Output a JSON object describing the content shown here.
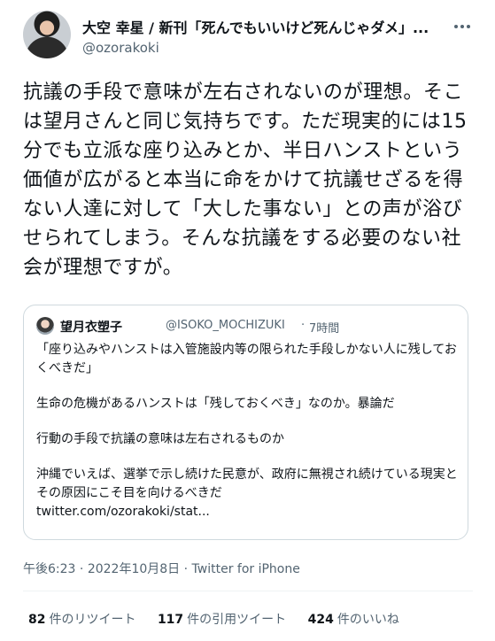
{
  "author": {
    "display_name": "大空 幸星 / 新刊「死んでもいいけど死んじゃダメ」...",
    "handle": "@ozorakoki"
  },
  "tweet": {
    "text": "抗議の手段で意味が左右されないのが理想。そこは望月さんと同じ気持ちです。ただ現実的には15分でも立派な座り込みとか、半日ハンストという価値が広がると本当に命をかけて抗議せざるを得ない人達に対して「大した事ない」との声が浴びせられてしまう。そんな抗議をする必要のない社会が理想ですが。"
  },
  "quote": {
    "name": "望月衣塑子",
    "handle": "@ISOKO_MOCHIZUKI",
    "separator": "·",
    "time": "7時間",
    "paragraphs": [
      "「座り込みやハンストは入管施設内等の限られた手段しかない人に残しておくべきだ」",
      "生命の危機があるハンストは「残しておくべき」なのか。暴論だ",
      "行動の手段で抗議の意味は左右されるものか",
      "沖縄でいえば、選挙で示し続けた民意が、政府に無視され続けている現実とその原因にこそ目を向けるべきだ"
    ],
    "link": "twitter.com/ozorakoki/stat..."
  },
  "meta": {
    "time": "午後6:23",
    "date": "2022年10月8日",
    "separator": "·",
    "source": "Twitter for iPhone"
  },
  "stats": {
    "retweets_count": "82",
    "retweets_label": "件のリツイート",
    "quotes_count": "117",
    "quotes_label": "件の引用ツイート",
    "likes_count": "424",
    "likes_label": "件のいいね"
  },
  "icons": {
    "more": "more-horizontal-icon"
  }
}
